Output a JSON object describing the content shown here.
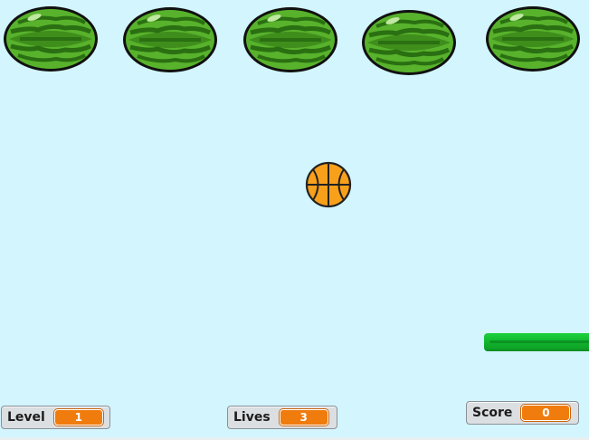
{
  "game": {
    "background_color": "#d2f5fe",
    "bricks": [
      {
        "sprite": "watermelon"
      },
      {
        "sprite": "watermelon"
      },
      {
        "sprite": "watermelon"
      },
      {
        "sprite": "watermelon"
      },
      {
        "sprite": "watermelon"
      }
    ],
    "ball": {
      "sprite": "basketball",
      "color": "#f9a01b"
    },
    "paddle": {
      "color": "#14c334"
    }
  },
  "monitors": {
    "level": {
      "label": "Level",
      "value": "1"
    },
    "lives": {
      "label": "Lives",
      "value": "3"
    },
    "score": {
      "label": "Score",
      "value": "0"
    }
  },
  "colors": {
    "monitor_value_bg": "#f07c0e",
    "melon_rind": "#3a9a1e",
    "melon_stripe": "#2a6f12"
  }
}
